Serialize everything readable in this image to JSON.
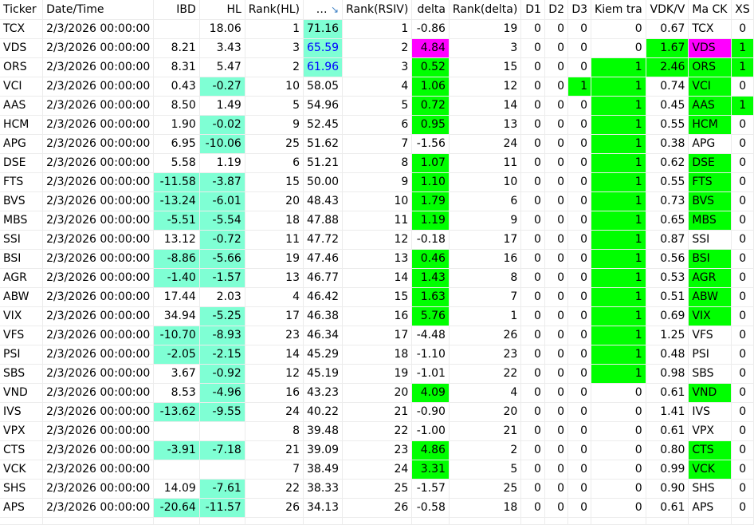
{
  "headers": [
    "Ticker",
    "Date/Time",
    "IBD",
    "HL",
    "Rank(HL)",
    "…",
    "Rank(RSIV)",
    "delta",
    "Rank(delta)",
    "D1",
    "D2",
    "D3",
    "Kiem tra",
    "VDK/V",
    "Ma CK",
    "XS"
  ],
  "sort_icon": "sort-descending-icon",
  "colors": {
    "cyan": "#7fffd4",
    "green": "#00ff00",
    "magenta": "#ff00ff",
    "blue_text": "#0000ff"
  },
  "rows": [
    {
      "ticker": "TCX",
      "dt": "2/3/2026 00:00:00",
      "ibd": "",
      "hl": "18.06",
      "rank_hl": "1",
      "rsi": "71.16",
      "rank_rsiv": "1",
      "delta": "-0.86",
      "rank_delta": "19",
      "d1": "0",
      "d2": "0",
      "d3": "0",
      "kiem": "0",
      "vdk": "0.67",
      "mack": "TCX",
      "xs": "0"
    },
    {
      "ticker": "VDS",
      "dt": "2/3/2026 00:00:00",
      "ibd": "8.21",
      "hl": "3.43",
      "rank_hl": "3",
      "rsi": "65.59",
      "rank_rsiv": "2",
      "delta": "4.84",
      "rank_delta": "3",
      "d1": "0",
      "d2": "0",
      "d3": "0",
      "kiem": "0",
      "vdk": "1.67",
      "mack": "VDS",
      "xs": "1"
    },
    {
      "ticker": "ORS",
      "dt": "2/3/2026 00:00:00",
      "ibd": "8.31",
      "hl": "5.47",
      "rank_hl": "2",
      "rsi": "61.96",
      "rank_rsiv": "3",
      "delta": "0.52",
      "rank_delta": "15",
      "d1": "0",
      "d2": "0",
      "d3": "0",
      "kiem": "1",
      "vdk": "2.46",
      "mack": "ORS",
      "xs": "1"
    },
    {
      "ticker": "VCI",
      "dt": "2/3/2026 00:00:00",
      "ibd": "0.43",
      "hl": "-0.27",
      "rank_hl": "10",
      "rsi": "58.05",
      "rank_rsiv": "4",
      "delta": "1.06",
      "rank_delta": "12",
      "d1": "0",
      "d2": "0",
      "d3": "1",
      "kiem": "1",
      "vdk": "0.74",
      "mack": "VCI",
      "xs": "0"
    },
    {
      "ticker": "AAS",
      "dt": "2/3/2026 00:00:00",
      "ibd": "8.50",
      "hl": "1.49",
      "rank_hl": "5",
      "rsi": "54.96",
      "rank_rsiv": "5",
      "delta": "0.72",
      "rank_delta": "14",
      "d1": "0",
      "d2": "0",
      "d3": "0",
      "kiem": "1",
      "vdk": "0.45",
      "mack": "AAS",
      "xs": "1"
    },
    {
      "ticker": "HCM",
      "dt": "2/3/2026 00:00:00",
      "ibd": "1.90",
      "hl": "-0.02",
      "rank_hl": "9",
      "rsi": "52.45",
      "rank_rsiv": "6",
      "delta": "0.95",
      "rank_delta": "13",
      "d1": "0",
      "d2": "0",
      "d3": "0",
      "kiem": "1",
      "vdk": "0.55",
      "mack": "HCM",
      "xs": "0"
    },
    {
      "ticker": "APG",
      "dt": "2/3/2026 00:00:00",
      "ibd": "6.95",
      "hl": "-10.06",
      "rank_hl": "25",
      "rsi": "51.62",
      "rank_rsiv": "7",
      "delta": "-1.56",
      "rank_delta": "24",
      "d1": "0",
      "d2": "0",
      "d3": "0",
      "kiem": "1",
      "vdk": "0.38",
      "mack": "APG",
      "xs": "0"
    },
    {
      "ticker": "DSE",
      "dt": "2/3/2026 00:00:00",
      "ibd": "5.58",
      "hl": "1.19",
      "rank_hl": "6",
      "rsi": "51.21",
      "rank_rsiv": "8",
      "delta": "1.07",
      "rank_delta": "11",
      "d1": "0",
      "d2": "0",
      "d3": "0",
      "kiem": "1",
      "vdk": "0.62",
      "mack": "DSE",
      "xs": "0"
    },
    {
      "ticker": "FTS",
      "dt": "2/3/2026 00:00:00",
      "ibd": "-11.58",
      "hl": "-3.87",
      "rank_hl": "15",
      "rsi": "50.00",
      "rank_rsiv": "9",
      "delta": "1.10",
      "rank_delta": "10",
      "d1": "0",
      "d2": "0",
      "d3": "0",
      "kiem": "1",
      "vdk": "0.55",
      "mack": "FTS",
      "xs": "0"
    },
    {
      "ticker": "BVS",
      "dt": "2/3/2026 00:00:00",
      "ibd": "-13.24",
      "hl": "-6.01",
      "rank_hl": "20",
      "rsi": "48.43",
      "rank_rsiv": "10",
      "delta": "1.79",
      "rank_delta": "6",
      "d1": "0",
      "d2": "0",
      "d3": "0",
      "kiem": "1",
      "vdk": "0.73",
      "mack": "BVS",
      "xs": "0"
    },
    {
      "ticker": "MBS",
      "dt": "2/3/2026 00:00:00",
      "ibd": "-5.51",
      "hl": "-5.54",
      "rank_hl": "18",
      "rsi": "47.88",
      "rank_rsiv": "11",
      "delta": "1.19",
      "rank_delta": "9",
      "d1": "0",
      "d2": "0",
      "d3": "0",
      "kiem": "1",
      "vdk": "0.65",
      "mack": "MBS",
      "xs": "0"
    },
    {
      "ticker": "SSI",
      "dt": "2/3/2026 00:00:00",
      "ibd": "13.12",
      "hl": "-0.72",
      "rank_hl": "11",
      "rsi": "47.72",
      "rank_rsiv": "12",
      "delta": "-0.18",
      "rank_delta": "17",
      "d1": "0",
      "d2": "0",
      "d3": "0",
      "kiem": "1",
      "vdk": "0.87",
      "mack": "SSI",
      "xs": "0"
    },
    {
      "ticker": "BSI",
      "dt": "2/3/2026 00:00:00",
      "ibd": "-8.86",
      "hl": "-5.66",
      "rank_hl": "19",
      "rsi": "47.46",
      "rank_rsiv": "13",
      "delta": "0.46",
      "rank_delta": "16",
      "d1": "0",
      "d2": "0",
      "d3": "0",
      "kiem": "1",
      "vdk": "0.56",
      "mack": "BSI",
      "xs": "0"
    },
    {
      "ticker": "AGR",
      "dt": "2/3/2026 00:00:00",
      "ibd": "-1.40",
      "hl": "-1.57",
      "rank_hl": "13",
      "rsi": "46.77",
      "rank_rsiv": "14",
      "delta": "1.43",
      "rank_delta": "8",
      "d1": "0",
      "d2": "0",
      "d3": "0",
      "kiem": "1",
      "vdk": "0.53",
      "mack": "AGR",
      "xs": "0"
    },
    {
      "ticker": "ABW",
      "dt": "2/3/2026 00:00:00",
      "ibd": "17.44",
      "hl": "2.03",
      "rank_hl": "4",
      "rsi": "46.42",
      "rank_rsiv": "15",
      "delta": "1.63",
      "rank_delta": "7",
      "d1": "0",
      "d2": "0",
      "d3": "0",
      "kiem": "1",
      "vdk": "0.51",
      "mack": "ABW",
      "xs": "0"
    },
    {
      "ticker": "VIX",
      "dt": "2/3/2026 00:00:00",
      "ibd": "34.94",
      "hl": "-5.25",
      "rank_hl": "17",
      "rsi": "46.38",
      "rank_rsiv": "16",
      "delta": "5.76",
      "rank_delta": "1",
      "d1": "0",
      "d2": "0",
      "d3": "0",
      "kiem": "1",
      "vdk": "0.69",
      "mack": "VIX",
      "xs": "0"
    },
    {
      "ticker": "VFS",
      "dt": "2/3/2026 00:00:00",
      "ibd": "-10.70",
      "hl": "-8.93",
      "rank_hl": "23",
      "rsi": "46.34",
      "rank_rsiv": "17",
      "delta": "-4.48",
      "rank_delta": "26",
      "d1": "0",
      "d2": "0",
      "d3": "0",
      "kiem": "1",
      "vdk": "1.25",
      "mack": "VFS",
      "xs": "0"
    },
    {
      "ticker": "PSI",
      "dt": "2/3/2026 00:00:00",
      "ibd": "-2.05",
      "hl": "-2.15",
      "rank_hl": "14",
      "rsi": "45.29",
      "rank_rsiv": "18",
      "delta": "-1.10",
      "rank_delta": "23",
      "d1": "0",
      "d2": "0",
      "d3": "0",
      "kiem": "1",
      "vdk": "0.48",
      "mack": "PSI",
      "xs": "0"
    },
    {
      "ticker": "SBS",
      "dt": "2/3/2026 00:00:00",
      "ibd": "3.67",
      "hl": "-0.92",
      "rank_hl": "12",
      "rsi": "45.19",
      "rank_rsiv": "19",
      "delta": "-1.01",
      "rank_delta": "22",
      "d1": "0",
      "d2": "0",
      "d3": "0",
      "kiem": "1",
      "vdk": "0.98",
      "mack": "SBS",
      "xs": "0"
    },
    {
      "ticker": "VND",
      "dt": "2/3/2026 00:00:00",
      "ibd": "8.53",
      "hl": "-4.96",
      "rank_hl": "16",
      "rsi": "43.23",
      "rank_rsiv": "20",
      "delta": "4.09",
      "rank_delta": "4",
      "d1": "0",
      "d2": "0",
      "d3": "0",
      "kiem": "0",
      "vdk": "0.61",
      "mack": "VND",
      "xs": "0"
    },
    {
      "ticker": "IVS",
      "dt": "2/3/2026 00:00:00",
      "ibd": "-13.62",
      "hl": "-9.55",
      "rank_hl": "24",
      "rsi": "40.22",
      "rank_rsiv": "21",
      "delta": "-0.90",
      "rank_delta": "20",
      "d1": "0",
      "d2": "0",
      "d3": "0",
      "kiem": "0",
      "vdk": "1.41",
      "mack": "IVS",
      "xs": "0"
    },
    {
      "ticker": "VPX",
      "dt": "2/3/2026 00:00:00",
      "ibd": "",
      "hl": "",
      "rank_hl": "8",
      "rsi": "39.48",
      "rank_rsiv": "22",
      "delta": "-1.00",
      "rank_delta": "21",
      "d1": "0",
      "d2": "0",
      "d3": "0",
      "kiem": "0",
      "vdk": "0.61",
      "mack": "VPX",
      "xs": "0"
    },
    {
      "ticker": "CTS",
      "dt": "2/3/2026 00:00:00",
      "ibd": "-3.91",
      "hl": "-7.18",
      "rank_hl": "21",
      "rsi": "39.09",
      "rank_rsiv": "23",
      "delta": "4.86",
      "rank_delta": "2",
      "d1": "0",
      "d2": "0",
      "d3": "0",
      "kiem": "0",
      "vdk": "0.80",
      "mack": "CTS",
      "xs": "0"
    },
    {
      "ticker": "VCK",
      "dt": "2/3/2026 00:00:00",
      "ibd": "",
      "hl": "",
      "rank_hl": "7",
      "rsi": "38.49",
      "rank_rsiv": "24",
      "delta": "3.31",
      "rank_delta": "5",
      "d1": "0",
      "d2": "0",
      "d3": "0",
      "kiem": "0",
      "vdk": "0.99",
      "mack": "VCK",
      "xs": "0"
    },
    {
      "ticker": "SHS",
      "dt": "2/3/2026 00:00:00",
      "ibd": "14.09",
      "hl": "-7.61",
      "rank_hl": "22",
      "rsi": "38.33",
      "rank_rsiv": "25",
      "delta": "-1.57",
      "rank_delta": "25",
      "d1": "0",
      "d2": "0",
      "d3": "0",
      "kiem": "0",
      "vdk": "0.90",
      "mack": "SHS",
      "xs": "0"
    },
    {
      "ticker": "APS",
      "dt": "2/3/2026 00:00:00",
      "ibd": "-20.64",
      "hl": "-11.57",
      "rank_hl": "26",
      "rsi": "34.13",
      "rank_rsiv": "26",
      "delta": "-0.58",
      "rank_delta": "18",
      "d1": "0",
      "d2": "0",
      "d3": "0",
      "kiem": "0",
      "vdk": "0.61",
      "mack": "APS",
      "xs": "0"
    }
  ]
}
